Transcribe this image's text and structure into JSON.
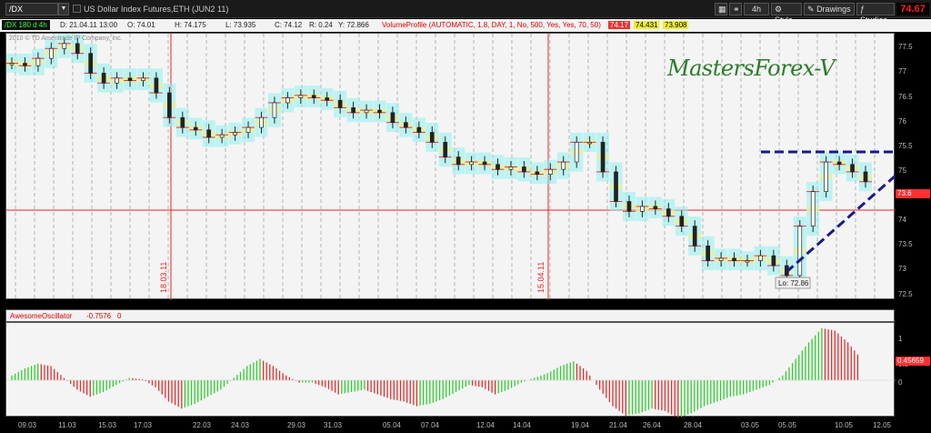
{
  "toolbar": {
    "symbol": "/DX",
    "description": "US Dollar Index Futures,ETH (JUN2 11)",
    "timeframe": "4h",
    "style_label": "Style",
    "drawings_label": "Drawings",
    "studies_label": "Studies",
    "last_price": "74.67"
  },
  "infobar": {
    "study_label": "/DX 180 d 4h",
    "date": "D: 21.04.11 13:00",
    "open": "O: 74.01",
    "high": "H: 74.175",
    "low": "L: 73.935",
    "close": "C: 74.12",
    "range": "R: 0.24",
    "y": "Y: 72.866",
    "volume_profile": "VolumeProfile (AUTOMATIC, 1.8, DAY, 1, No, 500, Yes, Yes, 70, 50)",
    "vp1": "74.17",
    "vp2": "74.431",
    "vp3": "73.908"
  },
  "chart_panel": {
    "copyright": "2010 © TD Ameritrade IP Company, Inc.",
    "watermark": "MastersForex-V",
    "marker1": "18.03.11",
    "marker2": "15.04.11",
    "low_label": "Lo: 72.86",
    "price_tag": "73.6"
  },
  "oscillator": {
    "name": "AwesomeOscillator",
    "value": "-0.7576",
    "zero": "0",
    "last_value": "0.45659",
    "yticks": [
      "1",
      "0.5",
      "0"
    ]
  },
  "colors": {
    "up_bar": "#33cc33",
    "down_bar": "#e03030",
    "accent": "#ff2020",
    "trendline": "#1a1a8c"
  },
  "chart_data": {
    "type": "candlestick",
    "ylim": [
      72.4,
      77.8
    ],
    "yticks": [
      "77.5",
      "77",
      "76.5",
      "76",
      "75.5",
      "75",
      "74.5",
      "74",
      "73.5",
      "73",
      "72.5"
    ],
    "xticks": [
      "09.03",
      "11.03",
      "15.03",
      "17.03",
      "22.03",
      "24.03",
      "29.03",
      "31.03",
      "05.04",
      "07.04",
      "12.04",
      "14.04",
      "19.04",
      "21.04",
      "26.04",
      "28.04",
      "03.05",
      "05.05",
      "10.05",
      "12.05"
    ],
    "close": [
      77.2,
      77.15,
      77.3,
      77.5,
      77.6,
      77.4,
      77.0,
      76.8,
      76.9,
      76.85,
      76.9,
      76.6,
      76.1,
      75.9,
      75.85,
      75.7,
      75.75,
      75.8,
      75.9,
      76.1,
      76.4,
      76.5,
      76.55,
      76.5,
      76.45,
      76.3,
      76.2,
      76.25,
      76.2,
      76.0,
      75.9,
      75.8,
      75.6,
      75.3,
      75.15,
      75.2,
      75.15,
      75.05,
      75.1,
      75.0,
      74.95,
      75.05,
      75.2,
      75.6,
      75.6,
      75.0,
      74.4,
      74.2,
      74.3,
      74.25,
      74.1,
      73.9,
      73.5,
      73.2,
      73.25,
      73.2,
      73.2,
      73.3,
      73.1,
      72.9,
      73.9,
      74.6,
      75.2,
      75.15,
      75.0,
      74.8
    ],
    "oscillator_values": [
      0.1,
      0.25,
      0.35,
      0.3,
      0.05,
      -0.2,
      -0.35,
      -0.25,
      -0.1,
      0.05,
      0.02,
      -0.15,
      -0.45,
      -0.6,
      -0.5,
      -0.35,
      -0.2,
      0.05,
      0.3,
      0.45,
      0.3,
      0.1,
      -0.05,
      -0.05,
      -0.15,
      -0.3,
      -0.25,
      -0.2,
      -0.3,
      -0.4,
      -0.45,
      -0.55,
      -0.5,
      -0.4,
      -0.25,
      -0.1,
      -0.15,
      -0.3,
      -0.2,
      -0.05,
      0.05,
      0.15,
      0.3,
      0.4,
      0.2,
      -0.2,
      -0.55,
      -0.75,
      -0.7,
      -0.6,
      -0.65,
      -0.8,
      -0.7,
      -0.55,
      -0.45,
      -0.35,
      -0.3,
      -0.2,
      -0.1,
      0.1,
      0.45,
      0.8,
      1.1,
      1.05,
      0.8,
      0.456
    ]
  }
}
